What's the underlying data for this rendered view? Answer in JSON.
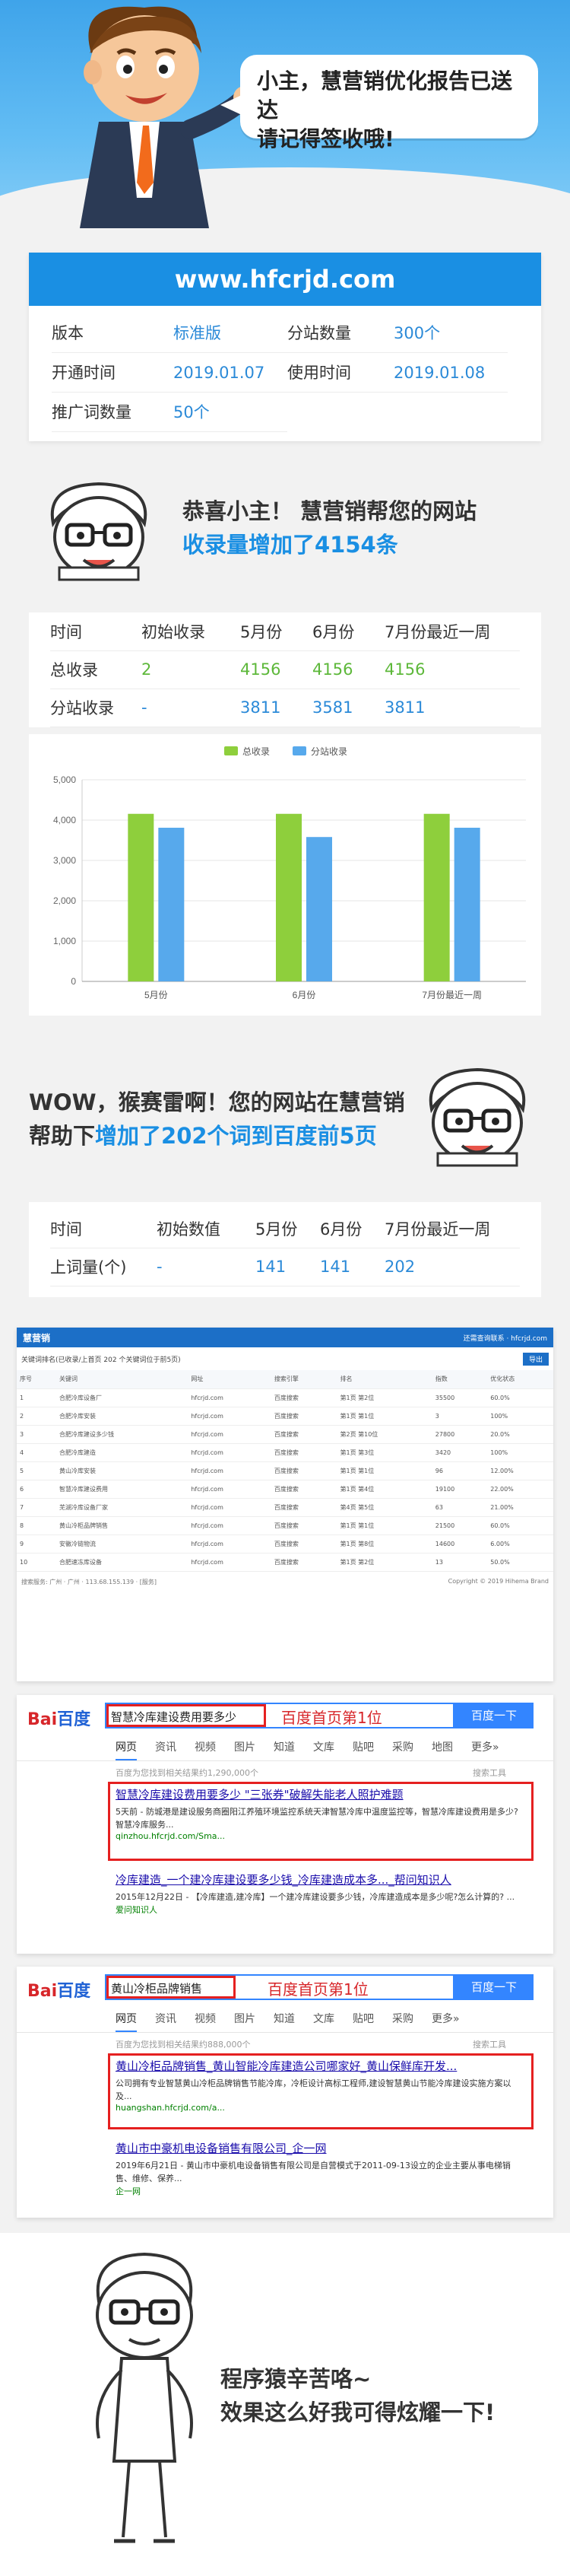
{
  "hero": {
    "speech_line1": "小主，慧营销优化报告已送达",
    "speech_line2": "请记得签收哦!"
  },
  "card": {
    "domain": "www.hfcrjd.com",
    "rows": [
      {
        "k1": "版本",
        "v1": "标准版",
        "k2": "分站数量",
        "v2": "300个"
      },
      {
        "k1": "开通时间",
        "v1": "2019.01.07",
        "k2": "使用时间",
        "v2": "2019.01.08"
      },
      {
        "k1": "推广词数量",
        "v1": "50个",
        "k2": "",
        "v2": ""
      }
    ]
  },
  "section1": {
    "line1": "恭喜小主！ 慧营销帮您的网站",
    "line2": "收录量增加了4154条"
  },
  "table1": {
    "headers": [
      "时间",
      "初始收录",
      "5月份",
      "6月份",
      "7月份最近一周"
    ],
    "rows": [
      {
        "label": "总收录",
        "c1": "2",
        "c2": "4156",
        "c3": "4156",
        "c4": "4156"
      },
      {
        "label": "分站收录",
        "c1": "-",
        "c2": "3811",
        "c3": "3581",
        "c4": "3811"
      }
    ]
  },
  "chart_data": {
    "type": "bar",
    "categories": [
      "5月份",
      "6月份",
      "7月份最近一周"
    ],
    "series": [
      {
        "name": "总收录",
        "color": "#8ecf3c",
        "values": [
          4156,
          4156,
          4156
        ]
      },
      {
        "name": "分站收录",
        "color": "#57a9ec",
        "values": [
          3811,
          3581,
          3811
        ]
      }
    ],
    "yticks": [
      "5,000",
      "4,000",
      "3,000",
      "2,000",
      "1,000",
      "0"
    ],
    "ylim": [
      0,
      5000
    ],
    "legend": "top"
  },
  "section2": {
    "line1": "WOW，猴赛雷啊！您的网站在慧营销",
    "line2_black": "帮助下",
    "line2_blue": "增加了202个词到百度前5页"
  },
  "table2": {
    "headers": [
      "时间",
      "初始数值",
      "5月份",
      "6月份",
      "7月份最近一周"
    ],
    "row": {
      "label": "上词量(个)",
      "c1": "-",
      "c2": "141",
      "c3": "141",
      "c4": "202"
    }
  },
  "screenshot": {
    "brand": "慧营销",
    "nav_right": "还需查询联系 · hfcrjd.com",
    "sub_title": "关键词排名(已收录/上首页 202 个关键词位于前5页)",
    "export_label": "导出",
    "columns": [
      "序号",
      "关键词",
      "网址",
      "搜索引擎",
      "排名",
      "指数",
      "优化状态"
    ],
    "rows": [
      [
        "1",
        "合肥冷库设备厂",
        "hfcrjd.com",
        "百度搜索",
        "第1页 第2位",
        "35500",
        "60.0%"
      ],
      [
        "2",
        "合肥冷库安装",
        "hfcrjd.com",
        "百度搜索",
        "第1页 第1位",
        "3",
        "100%"
      ],
      [
        "3",
        "合肥冷库建设多少钱",
        "hfcrjd.com",
        "百度搜索",
        "第2页 第10位",
        "27800",
        "20.0%"
      ],
      [
        "4",
        "合肥冷库建造",
        "hfcrjd.com",
        "百度搜索",
        "第1页 第3位",
        "3420",
        "100%"
      ],
      [
        "5",
        "黄山冷库安装",
        "hfcrjd.com",
        "百度搜索",
        "第1页 第1位",
        "96",
        "12.00%"
      ],
      [
        "6",
        "智慧冷库建设费用",
        "hfcrjd.com",
        "百度搜索",
        "第1页 第4位",
        "19100",
        "22.00%"
      ],
      [
        "7",
        "芜湖冷库设备厂家",
        "hfcrjd.com",
        "百度搜索",
        "第4页 第5位",
        "63",
        "21.00%"
      ],
      [
        "8",
        "黄山冷柜品牌销售",
        "hfcrjd.com",
        "百度搜索",
        "第1页 第1位",
        "21500",
        "60.0%"
      ],
      [
        "9",
        "安徽冷链物流",
        "hfcrjd.com",
        "百度搜索",
        "第1页 第8位",
        "14600",
        "6.00%"
      ],
      [
        "10",
        "合肥速冻库设备",
        "hfcrjd.com",
        "百度搜索",
        "第1页 第2位",
        "13",
        "50.0%"
      ]
    ],
    "footer_left": "搜索服务: 广州 · 广州 · 113.68.155.139 · [服务]",
    "footer_right": "Copyright © 2019 Hihema Brand"
  },
  "baidu1": {
    "logo_a": "Bai",
    "logo_b": "百度",
    "query": "智慧冷库建设费用要多少",
    "stamp": "百度首页第1位",
    "button": "百度一下",
    "tabs": [
      "网页",
      "资讯",
      "视频",
      "图片",
      "知道",
      "文库",
      "贴吧",
      "采购",
      "地图",
      "更多»"
    ],
    "count": "百度为您找到相关结果约1,290,000个",
    "tools": "搜索工具",
    "r1_title": "智慧冷库建设费用要多少 \"三张券\"破解失能老人照护难题",
    "r1_body": "5天前 - 防城港是建设服务商圈阳江养殖环境监控系统天津智慧冷库中温度监控等，智慧冷库建设费用是多少?智慧冷库服务...",
    "r1_url": "qinzhou.hfcrjd.com/Sma...",
    "r2_title": "冷库建造_一个建冷库建设要多少钱_冷库建造成本多..._帮问知识人",
    "r2_body": "2015年12月22日 - 【冷库建造,建冷库】一个建冷库建设要多少钱，冷库建造成本是多少呢?怎么计算的? ...",
    "r2_url": "爱问知识人"
  },
  "baidu2": {
    "logo_a": "Bai",
    "logo_b": "百度",
    "query": "黄山冷柜品牌销售",
    "stamp": "百度首页第1位",
    "button": "百度一下",
    "tabs": [
      "网页",
      "资讯",
      "视频",
      "图片",
      "知道",
      "文库",
      "贴吧",
      "采购",
      "更多»"
    ],
    "count": "百度为您找到相关结果约888,000个",
    "tools": "搜索工具",
    "r1_title": "黄山冷柜品牌销售_黄山智能冷库建造公司哪家好_黄山保鲜库开发...",
    "r1_body": "公司拥有专业智慧黄山冷柜品牌销售节能冷库，冷柜设计高标工程师,建设智慧黄山节能冷库建设实施方案以及...",
    "r1_url": "huangshan.hfcrjd.com/a...",
    "r2_title": "黄山市中豪机电设备销售有限公司_企一网",
    "r2_body": "2019年6月21日 - 黄山市中豪机电设备销售有限公司是自营模式于2011-09-13设立的企业主要从事电梯销售、维修、保养...",
    "r2_url": "企一网"
  },
  "closing": {
    "line1": "程序猿辛苦咯~",
    "line2": "效果这么好我可得炫耀一下!"
  }
}
